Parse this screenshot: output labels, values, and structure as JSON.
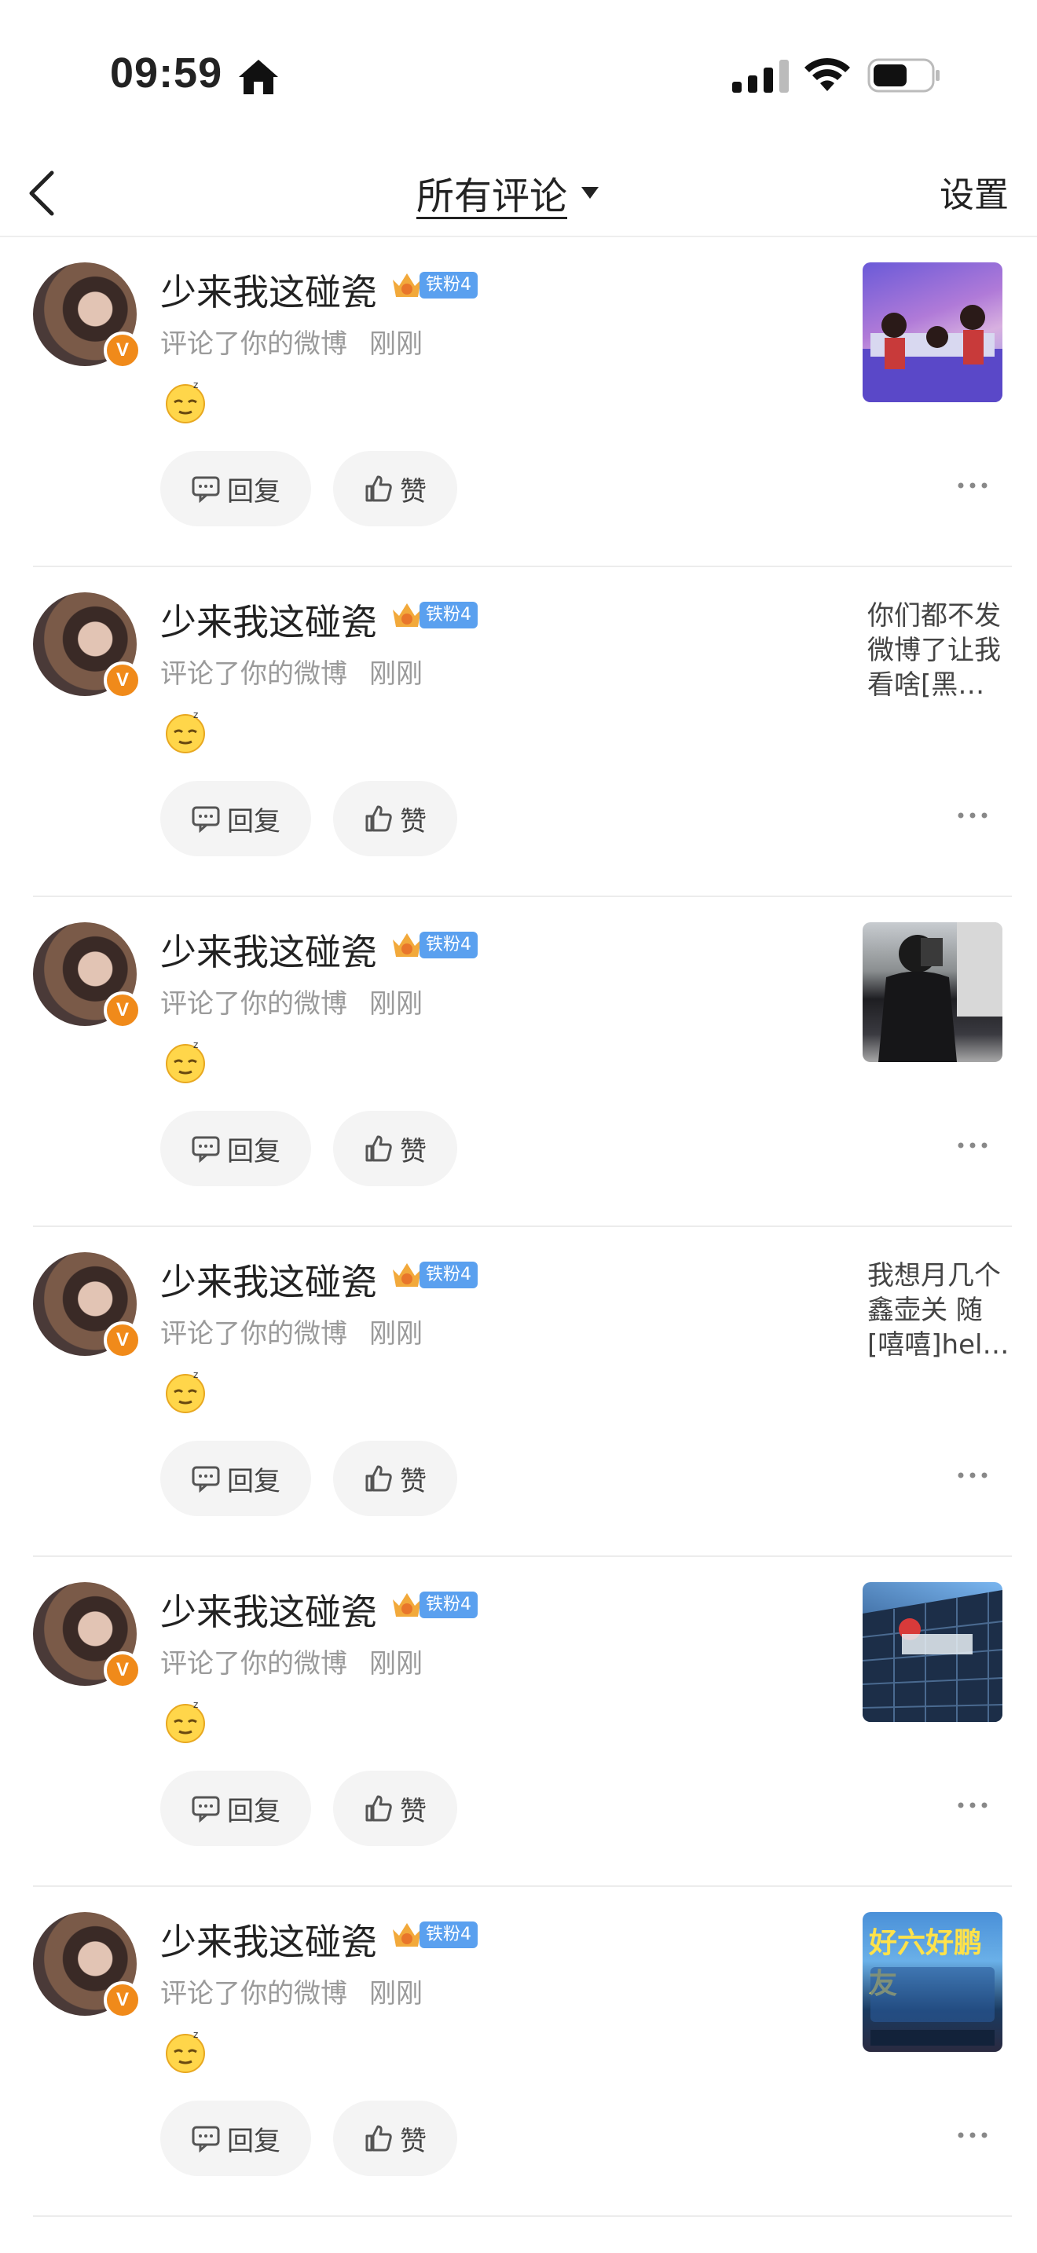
{
  "status_bar": {
    "time": "09:59"
  },
  "nav": {
    "title": "所有评论",
    "settings": "设置"
  },
  "items": [
    {
      "name": "少来我这碰瓷",
      "fan_label": "铁粉4",
      "action": "评论了你的微博",
      "time_ago": "刚刚",
      "reply": "回复",
      "like": "赞",
      "preview_type": "image",
      "preview_text": ""
    },
    {
      "name": "少来我这碰瓷",
      "fan_label": "铁粉4",
      "action": "评论了你的微博",
      "time_ago": "刚刚",
      "reply": "回复",
      "like": "赞",
      "preview_type": "text",
      "preview_text": "你们都不发微博了让我看啥[黑…"
    },
    {
      "name": "少来我这碰瓷",
      "fan_label": "铁粉4",
      "action": "评论了你的微博",
      "time_ago": "刚刚",
      "reply": "回复",
      "like": "赞",
      "preview_type": "image",
      "preview_text": ""
    },
    {
      "name": "少来我这碰瓷",
      "fan_label": "铁粉4",
      "action": "评论了你的微博",
      "time_ago": "刚刚",
      "reply": "回复",
      "like": "赞",
      "preview_type": "text",
      "preview_text": "我想月几个鑫壶关 随[嘻嘻]hel…"
    },
    {
      "name": "少来我这碰瓷",
      "fan_label": "铁粉4",
      "action": "评论了你的微博",
      "time_ago": "刚刚",
      "reply": "回复",
      "like": "赞",
      "preview_type": "image",
      "preview_text": ""
    },
    {
      "name": "少来我这碰瓷",
      "fan_label": "铁粉4",
      "action": "评论了你的微博",
      "time_ago": "刚刚",
      "reply": "回复",
      "like": "赞",
      "preview_type": "image",
      "preview_text": "好六好鹏友"
    }
  ],
  "colors": {
    "accent_orange": "#f08a1a",
    "fan_blue": "#5aa0ef",
    "muted_text": "#9a9a9a"
  }
}
